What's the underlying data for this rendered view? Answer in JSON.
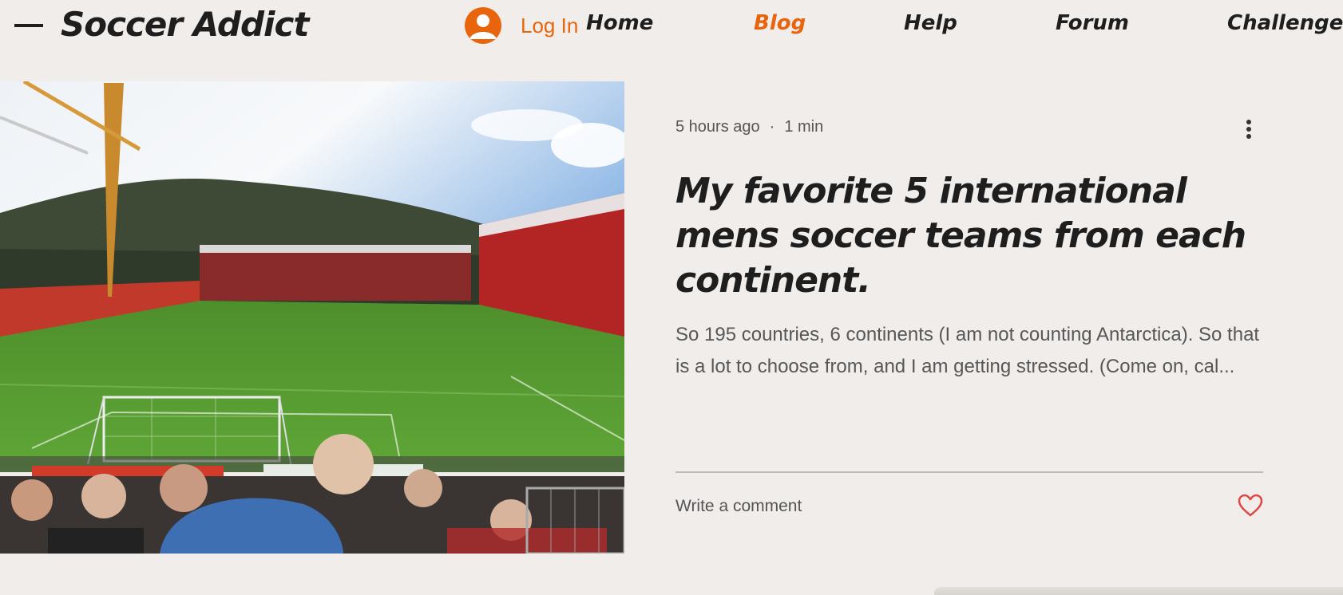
{
  "header": {
    "site_title": "Soccer Addict",
    "login_label": "Log In",
    "nav": [
      {
        "label": "Home",
        "active": false
      },
      {
        "label": "Blog",
        "active": true
      },
      {
        "label": "Help",
        "active": false
      },
      {
        "label": "Forum",
        "active": false
      },
      {
        "label": "Challenges",
        "active": false
      }
    ],
    "menu_icon": "hamburger-menu-icon",
    "avatar_icon": "user-avatar-icon"
  },
  "post": {
    "time_ago": "5 hours ago",
    "separator": "·",
    "read_time": "1 min",
    "title": "My favorite 5 international mens soccer teams from each continent.",
    "excerpt": "So 195 countries, 6 continents (I am not counting Antarctica). So that is a lot to choose from, and I am getting stressed. (Come on, cal...",
    "comment_label": "Write a comment",
    "more_icon": "more-options-icon",
    "like_icon": "heart-icon",
    "cover_image": "soccer-stadium-photo"
  },
  "colors": {
    "background": "#f0edea",
    "accent": "#e8650e",
    "text": "#1e1e1e",
    "like": "#e04848"
  }
}
